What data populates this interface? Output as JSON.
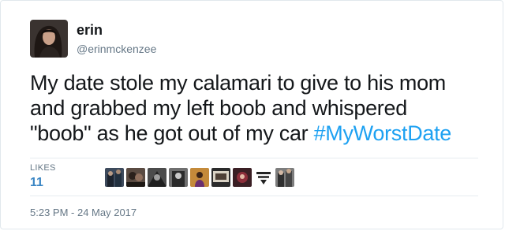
{
  "user": {
    "display_name": "erin",
    "handle": "@erinmckenzee",
    "avatar_icon": "profile-photo"
  },
  "tweet": {
    "lines": [
      "My date stole my calamari to give to his mom",
      "and grabbed my left boob and whispered",
      "\"boob\" as he got out of my car "
    ],
    "hashtag": "#MyWorstDate"
  },
  "stats": {
    "likes_label": "LIKES",
    "likes_count": "11"
  },
  "likers": {
    "count_shown": 9,
    "icons": [
      "liker-avatar",
      "liker-avatar",
      "liker-avatar",
      "liker-avatar",
      "liker-avatar",
      "liker-avatar",
      "liker-avatar",
      "liker-avatar",
      "liker-avatar"
    ]
  },
  "footer": {
    "timestamp": "5:23 PM - 24 May 2017"
  },
  "colors": {
    "hashtag": "#1da1f2",
    "likes_count": "#3b86c4",
    "secondary_text": "#657786",
    "divider": "#e6ecf0"
  }
}
